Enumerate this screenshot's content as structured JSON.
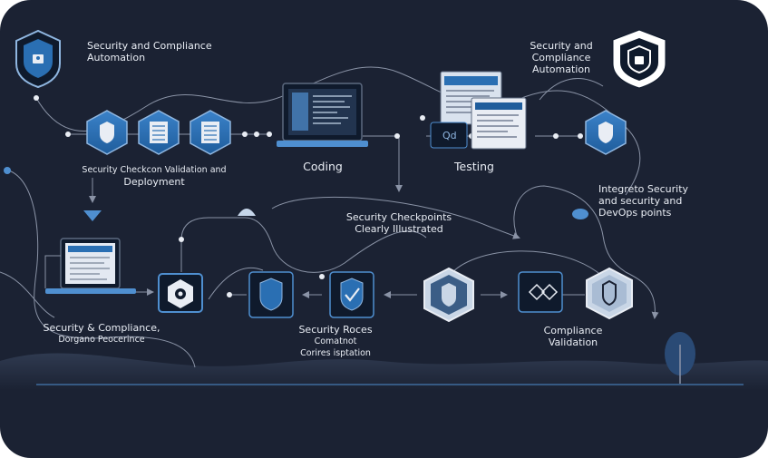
{
  "labels": {
    "top_left": [
      "Security and Compliance",
      "Automation"
    ],
    "top_right": [
      "Security and",
      "Compliance",
      "Automation"
    ],
    "checks_validation": [
      "Security Checkcon Validation and",
      "Deployment"
    ],
    "coding": "Coding",
    "testing": "Testing",
    "testing_badge": "Qd",
    "integrate": [
      "Integreto Security",
      "and security and",
      "DevOps points"
    ],
    "checkpoints": [
      "Security Checkpoints",
      "Clearly Illustrated"
    ],
    "sec_compliance": [
      "Security & Compliance,",
      "Dorgano Peocerince"
    ],
    "sec_process": [
      "Security Roces",
      "Comatnot",
      "Corires isptation"
    ],
    "compliance_validation": [
      "Compliance",
      "Validation"
    ]
  },
  "colors": {
    "background": "#1b2233",
    "line": "#8a93a6",
    "accent": "#4f8fd0",
    "icon_fill": "#2a6fb3",
    "hex_outline": "#8fb6e0",
    "text": "#e9edf4"
  }
}
